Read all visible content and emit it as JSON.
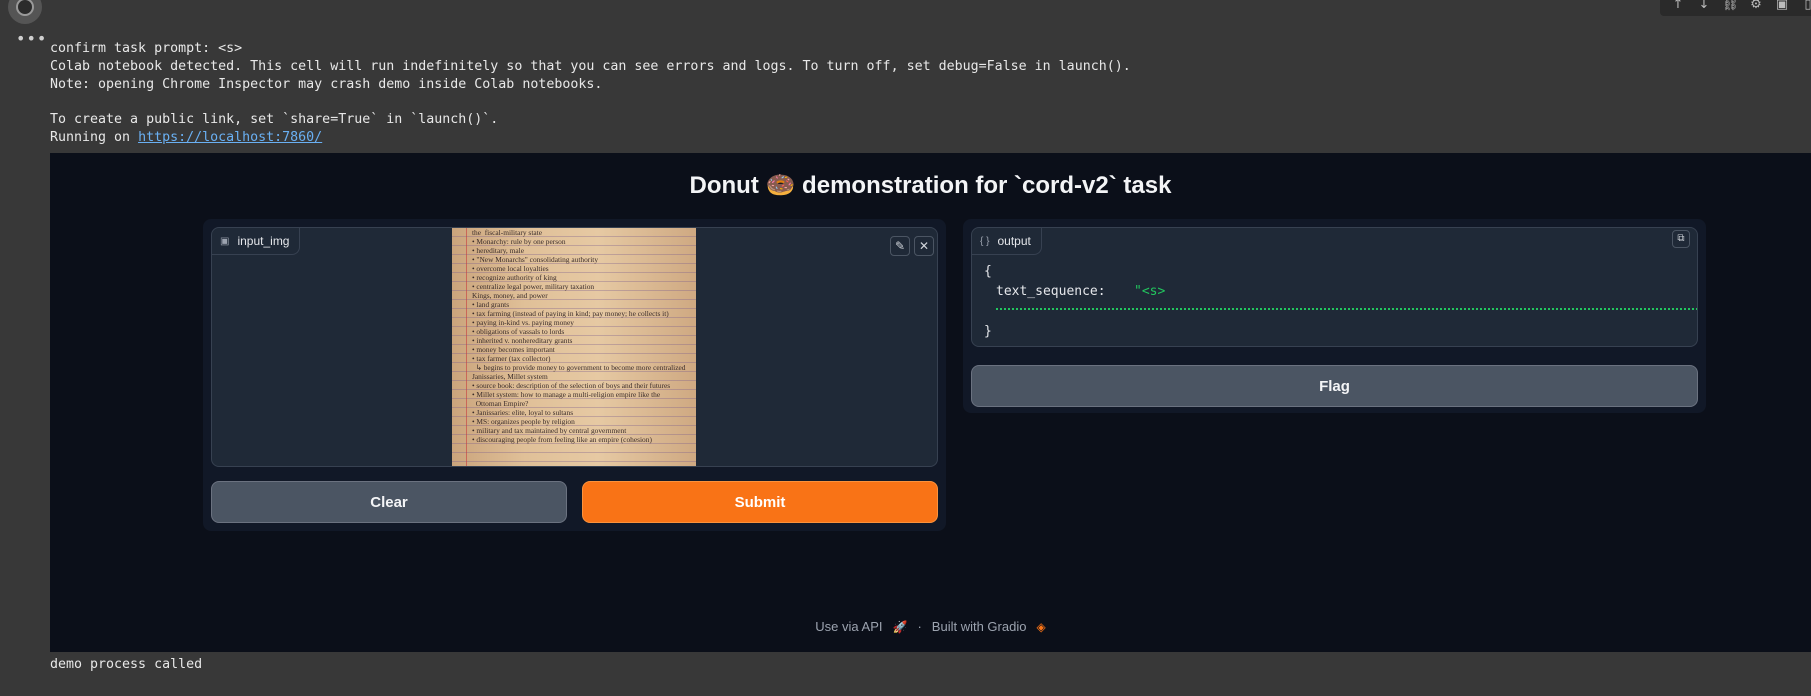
{
  "colab": {
    "more_glyph": "•••",
    "toolbar_icons": [
      "arrow-up-icon",
      "arrow-down-icon",
      "link-icon",
      "gear-icon",
      "notebook-icon",
      "more-icon"
    ]
  },
  "console": {
    "line1": "confirm task prompt: <s>",
    "line2": "Colab notebook detected. This cell will run indefinitely so that you can see errors and logs. To turn off, set debug=False in launch().",
    "line3": "Note: opening Chrome Inspector may crash demo inside Colab notebooks.",
    "line4": "To create a public link, set `share=True` in `launch()`.",
    "line5_prefix": "Running on ",
    "line5_link": "https://localhost:7860/",
    "after": "demo process called"
  },
  "app": {
    "title": "Donut 🍩 demonstration for `cord-v2` task",
    "input_label": "input_img",
    "output_label": "output",
    "clear_label": "Clear",
    "submit_label": "Submit",
    "flag_label": "Flag",
    "json_open": "{",
    "json_key": "text_sequence:",
    "json_value": "\"<s>",
    "json_close": "}",
    "footer_api": "Use via API",
    "footer_sep": "·",
    "footer_built": "Built with Gradio",
    "colors": {
      "primary": "#f97316",
      "bg": "#0b0f19",
      "panel": "#111827",
      "block": "#1f2937",
      "string": "#22c55e"
    }
  },
  "handwriting": [
    "the  fiscal-military state",
    "• Monarchy: rule by one person",
    "• hereditary, male",
    "• \"New Monarchs\" consolidating authority",
    "• overcome local loyalties",
    "• recognize authority of king",
    "• centralize legal power, military taxation",
    "",
    "Kings, money, and power",
    "• land grants",
    "• tax farming (instead of paying in kind; pay money; he collects it)",
    "• paying in-kind vs. paying money",
    "• obligations of vassals to lords",
    "• inherited v. nonhereditary grants",
    "• money becomes important",
    "• tax farmer (tax collector)",
    "  ↳ begins to provide money to government to become more centralized",
    "",
    "Janissaries, Millet system",
    "• source book: description of the selection of boys and their futures",
    "• Millet system: how to manage a multi-religion empire like the",
    "  Ottoman Empire?",
    "• Janissaries: elite, loyal to sultans",
    "• MS: organizes people by religion",
    "• military and tax maintained by central government",
    "• discouraging people from feeling like an empire (cohesion)"
  ]
}
